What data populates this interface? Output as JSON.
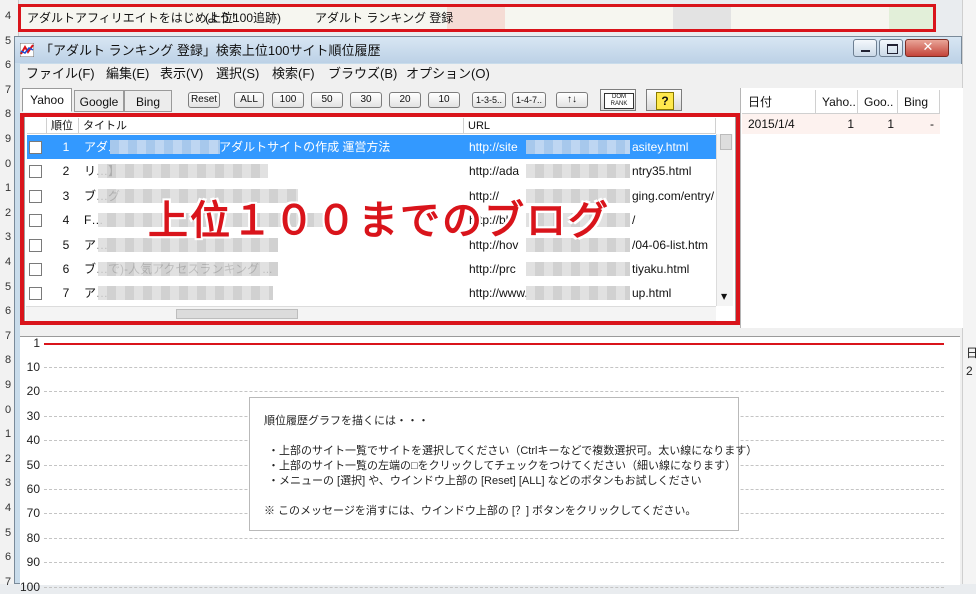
{
  "banner": {
    "text1": "アダルトアフィリエイトをはじめよう！",
    "text2": "(上位100追跡)",
    "text3": "アダルト ランキング 登録"
  },
  "spreadsheet": {
    "row_numbers": [
      "4",
      "5",
      "6",
      "7",
      "8",
      "9",
      "0",
      "1",
      "2",
      "3",
      "4",
      "5",
      "6",
      "7",
      "8",
      "9",
      "0",
      "1",
      "2",
      "3",
      "4",
      "5",
      "6",
      "7"
    ],
    "right_texts": [
      "日",
      "2"
    ]
  },
  "window": {
    "title": "「アダルト ランキング 登録」検索上位100サイト順位履歴",
    "minimize": "minimize",
    "maximize": "maximize",
    "close": "close"
  },
  "menu": [
    {
      "label": "ファイル(F)"
    },
    {
      "label": "編集(E)"
    },
    {
      "label": "表示(V)"
    },
    {
      "label": "選択(S)"
    },
    {
      "label": "検索(F)"
    },
    {
      "label": "ブラウズ(B)"
    },
    {
      "label": "オプション(O)"
    }
  ],
  "tabs": [
    {
      "label": "Yahoo",
      "active": true
    },
    {
      "label": "Google",
      "active": false
    },
    {
      "label": "Bing",
      "active": false
    }
  ],
  "toolbar": {
    "reset": "Reset",
    "all": "ALL",
    "n100": "100",
    "n50": "50",
    "n30": "30",
    "n20": "20",
    "n10": "10",
    "range1": "1-3-5..",
    "range2": "1-4-7..",
    "sort": "↑↓",
    "domrank": "DOM RANK",
    "help": "?"
  },
  "list": {
    "headers": {
      "rank": "順位",
      "title": "タイトル",
      "url": "URL"
    },
    "rows": [
      {
        "rank": "1",
        "title": "アダルトアフィリエイト アダルトサイトの作成 運営方法",
        "url": "http://site…asitey.html",
        "url_a": "http://site",
        "url_b": "asitey.html"
      },
      {
        "rank": "2",
        "title": "リ…】",
        "url_a": "http://ada",
        "url_b": "ntry35.html"
      },
      {
        "rank": "3",
        "title": "ブ…グ",
        "url_a": "http://",
        "url_b": "ging.com/entry/"
      },
      {
        "rank": "4",
        "title": "F…",
        "url_a": "http://blo",
        "url_b": "/"
      },
      {
        "rank": "5",
        "title": "ア…",
        "url_a": "http://hov",
        "url_b": "/04-06-list.htm"
      },
      {
        "rank": "6",
        "title": "ブ…で)-人気アクセスランキング ...",
        "url_a": "http://prc",
        "url_b": "tiyaku.html"
      },
      {
        "rank": "7",
        "title": "ア…",
        "url_a": "http://www.",
        "url_b": "up.html"
      }
    ],
    "overlay": "上位１００までのブログ"
  },
  "right_table": {
    "headers": [
      "日付",
      "Yaho..",
      "Goo..",
      "Bing"
    ],
    "rows": [
      {
        "date": "2015/1/4",
        "yahoo": "1",
        "google": "1",
        "bing": "-"
      }
    ]
  },
  "graph": {
    "y_labels": [
      "1",
      "10",
      "20",
      "30",
      "40",
      "50",
      "60",
      "70",
      "80",
      "90",
      "100"
    ],
    "message": {
      "line1": "順位履歴グラフを描くには・・・",
      "line2": "・上部のサイト一覧でサイトを選択してください（Ctrlキーなどで複数選択可。太い線になります）",
      "line3": "・上部のサイト一覧の左端の□をクリックしてチェックをつけてください（細い線になります）",
      "line4": "・メニューの [選択] や、ウインドウ上部の [Reset] [ALL] などのボタンもお試しください",
      "line5": "※ このメッセージを消すには、ウインドウ上部の [？] ボタンをクリックしてください。"
    }
  },
  "colors": {
    "highlight_red": "#d9141b",
    "selection_blue": "#3399ff",
    "graph_red_line": "#d9141b"
  }
}
